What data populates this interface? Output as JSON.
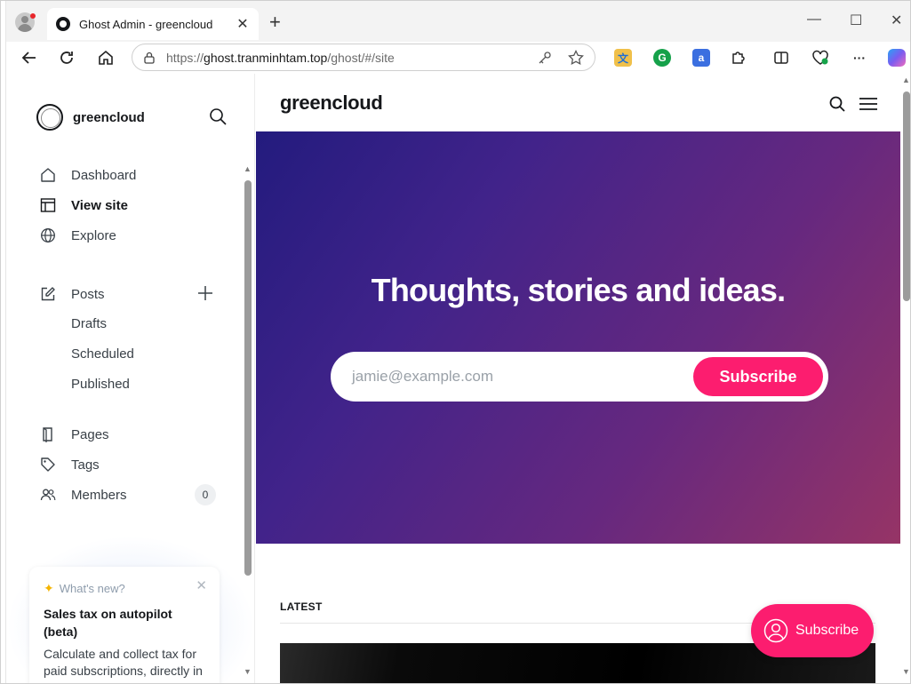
{
  "browser": {
    "tab_title": "Ghost Admin - greencloud",
    "url_prefix": "https://",
    "url_host": "ghost.tranminhtam.top",
    "url_path": "/ghost/#/site",
    "new_tab_glyph": "+",
    "close_glyph": "✕",
    "minimize_glyph": "—",
    "maximize_glyph": "☐",
    "window_close_glyph": "✕",
    "more_glyph": "···"
  },
  "sidebar": {
    "site_name": "greencloud",
    "nav": [
      {
        "label": "Dashboard",
        "icon": "home-icon"
      },
      {
        "label": "View site",
        "icon": "layout-icon",
        "active": true
      },
      {
        "label": "Explore",
        "icon": "globe-icon"
      }
    ],
    "posts": {
      "label": "Posts",
      "subitems": [
        "Drafts",
        "Scheduled",
        "Published"
      ]
    },
    "pages_label": "Pages",
    "tags_label": "Tags",
    "members_label": "Members",
    "members_count": "0"
  },
  "whats_new": {
    "header": "What's new?",
    "title": "Sales tax on autopilot (beta)",
    "body": "Calculate and collect tax for paid subscriptions, directly in Stripe Checkout"
  },
  "site": {
    "logo": "greencloud",
    "hero_title": "Thoughts, stories and ideas.",
    "email_placeholder": "jamie@example.com",
    "subscribe_label": "Subscribe",
    "latest_label": "LATEST",
    "floating_subscribe_label": "Subscribe"
  },
  "colors": {
    "accent": "#fc1d6f",
    "hero_gradient_start": "#231b7e",
    "hero_gradient_end": "#963466"
  }
}
